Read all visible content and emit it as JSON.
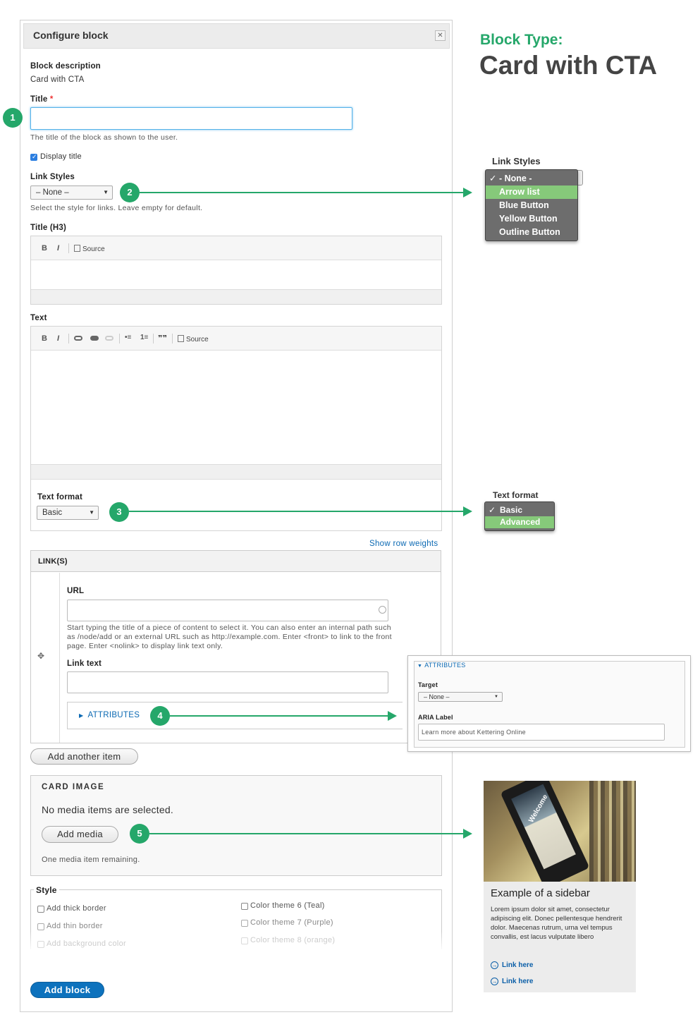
{
  "dialog": {
    "title": "Configure block",
    "close_icon": "close-icon",
    "block_description_label": "Block description",
    "block_description_value": "Card with CTA",
    "title_label": "Title",
    "title_required": "*",
    "title_value": "",
    "title_help": "The title of the block as shown to the user.",
    "display_title_label": "Display title",
    "display_title_checked": true,
    "link_styles_label": "Link Styles",
    "link_styles_value": "– None –",
    "link_styles_help": "Select the style for links. Leave empty for default.",
    "title_h3_label": "Title (H3)",
    "text_label": "Text",
    "text_format_label": "Text format",
    "text_format_value": "Basic",
    "show_row_weights": "Show row weights",
    "links_header": "LINK(S)",
    "url_label": "URL",
    "url_value": "",
    "url_help_1": "Start typing the title of a piece of content to select it. You can also enter an internal path such",
    "url_help_2": "as /node/add or an external URL such as http://example.com. Enter <front> to link to the front",
    "url_help_3": "page. Enter <nolink> to display link text only.",
    "link_text_label": "Link text",
    "link_text_value": "",
    "attributes_label": "ATTRIBUTES",
    "add_another_item": "Add another item",
    "card_image_label": "CARD IMAGE",
    "no_media": "No media items are selected.",
    "add_media": "Add media",
    "media_remaining": "One media item remaining.",
    "style_legend": "Style",
    "style_options_left": [
      "Add thick border",
      "Add thin border",
      "Add background color"
    ],
    "style_options_right": [
      "Color theme 6 (Teal)",
      "Color theme 7 (Purple)",
      "Color theme 8 (orange)"
    ],
    "add_block": "Add block"
  },
  "editor_toolbar": {
    "bold": "B",
    "italic": "I",
    "source": "Source",
    "blockquote": "❞❞"
  },
  "callout": {
    "type_label": "Block Type:",
    "type_value": "Card with CTA",
    "accent_color": "#25a76a",
    "badges": [
      "1",
      "2",
      "3",
      "4",
      "5"
    ]
  },
  "link_styles_menu": {
    "title": "Link Styles",
    "options": [
      "- None -",
      "Arrow list",
      "Blue Button",
      "Yellow Button",
      "Outline Button"
    ],
    "selected": "- None -",
    "highlighted": "Arrow list"
  },
  "text_format_menu": {
    "title": "Text format",
    "options": [
      "Basic",
      "Advanced"
    ],
    "selected": "Basic",
    "highlighted": "Advanced"
  },
  "attributes_panel": {
    "header": "ATTRIBUTES",
    "target_label": "Target",
    "target_value": "– None –",
    "aria_label": "ARIA Label",
    "aria_value": "Learn more about Kettering Online"
  },
  "sidebar_example": {
    "image_text": "Welcome",
    "title": "Example of a sidebar",
    "body": "Lorem ipsum dolor sit amet, consectetur adipiscing elit. Donec pellentesque hendrerit dolor. Maecenas rutrum, urna vel tempus convallis, est lacus vulputate libero",
    "links": [
      "Link here",
      "Link here"
    ]
  }
}
